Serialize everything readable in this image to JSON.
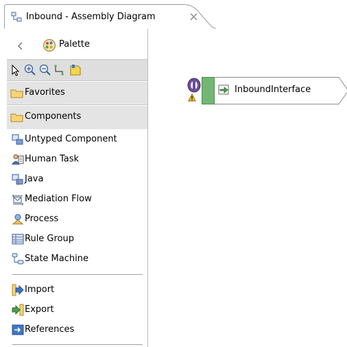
{
  "editor": {
    "tab_title": "Inbound - Assembly Diagram",
    "tab_close_icon": "close-icon"
  },
  "palette": {
    "title": "Palette",
    "collapse_icon": "collapse-left-icon",
    "tools": [
      "select-arrow-icon",
      "zoom-in-icon",
      "zoom-out-icon",
      "wire-icon",
      "note-icon"
    ],
    "drawers": [
      {
        "label": "Favorites",
        "icon": "folder-icon"
      },
      {
        "label": "Components",
        "icon": "folder-icon"
      }
    ],
    "components": [
      {
        "label": "Untyped Component",
        "icon": "untyped-component-icon"
      },
      {
        "label": "Human Task",
        "icon": "human-task-icon"
      },
      {
        "label": "Java",
        "icon": "java-icon"
      },
      {
        "label": "Mediation Flow",
        "icon": "mediation-flow-icon"
      },
      {
        "label": "Process",
        "icon": "process-icon"
      },
      {
        "label": "Rule Group",
        "icon": "rule-group-icon"
      },
      {
        "label": "State Machine",
        "icon": "state-machine-icon"
      }
    ],
    "imports": [
      {
        "label": "Import",
        "icon": "import-icon"
      },
      {
        "label": "Export",
        "icon": "export-icon"
      },
      {
        "label": "References",
        "icon": "references-icon"
      }
    ]
  },
  "canvas": {
    "component_label": "InboundInterface",
    "interface_icon": "interface-icon",
    "warning_icon": "warning-icon",
    "colors": {
      "interface_green": "#6db36d",
      "interface_purple": "#7b5aa8",
      "component_border": "#8c8c8c"
    }
  }
}
